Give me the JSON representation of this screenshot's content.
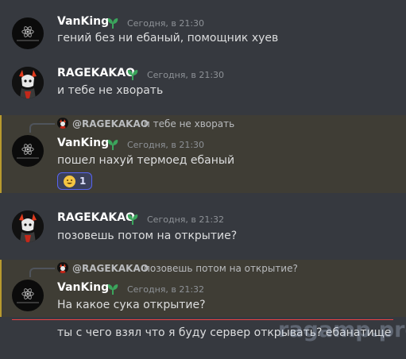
{
  "messages": [
    {
      "author": "VanKing",
      "timestamp": "Сегодня, в 21:30",
      "text": "гений без ни ебаный, помощник хуев"
    },
    {
      "author": "RAGEKAKAO",
      "timestamp": "Сегодня, в 21:30",
      "text": "и тебе не хворать"
    },
    {
      "author": "VanKing",
      "timestamp": "Сегодня, в 21:30",
      "text": "пошел нахуй термоед ебаный",
      "reply": {
        "author": "@RAGEKAKAO",
        "text": "и тебе не хворать"
      },
      "reaction": {
        "emoji": "grinning-face-emoji",
        "count": "1"
      }
    },
    {
      "author": "RAGEKAKAO",
      "timestamp": "Сегодня, в 21:32",
      "text": "позовешь потом на открытие?"
    },
    {
      "author": "VanKing",
      "timestamp": "Сегодня, в 21:32",
      "text": "На какое сука открытие?",
      "reply": {
        "author": "@RAGEKAKAO",
        "text": "позовешь потом на открытие?"
      }
    }
  ],
  "continuation": {
    "text": "ты с чего взял что я буду сервер открывать? ебанатище"
  },
  "watermark": "ragamp.pro",
  "colors": {
    "background": "#36393f",
    "highlight_background": "#3f3d35",
    "highlight_border": "#b89a2e",
    "badge_green": "#3ba55c",
    "new_divider": "#ed4245",
    "reaction_border": "#5865f2"
  }
}
